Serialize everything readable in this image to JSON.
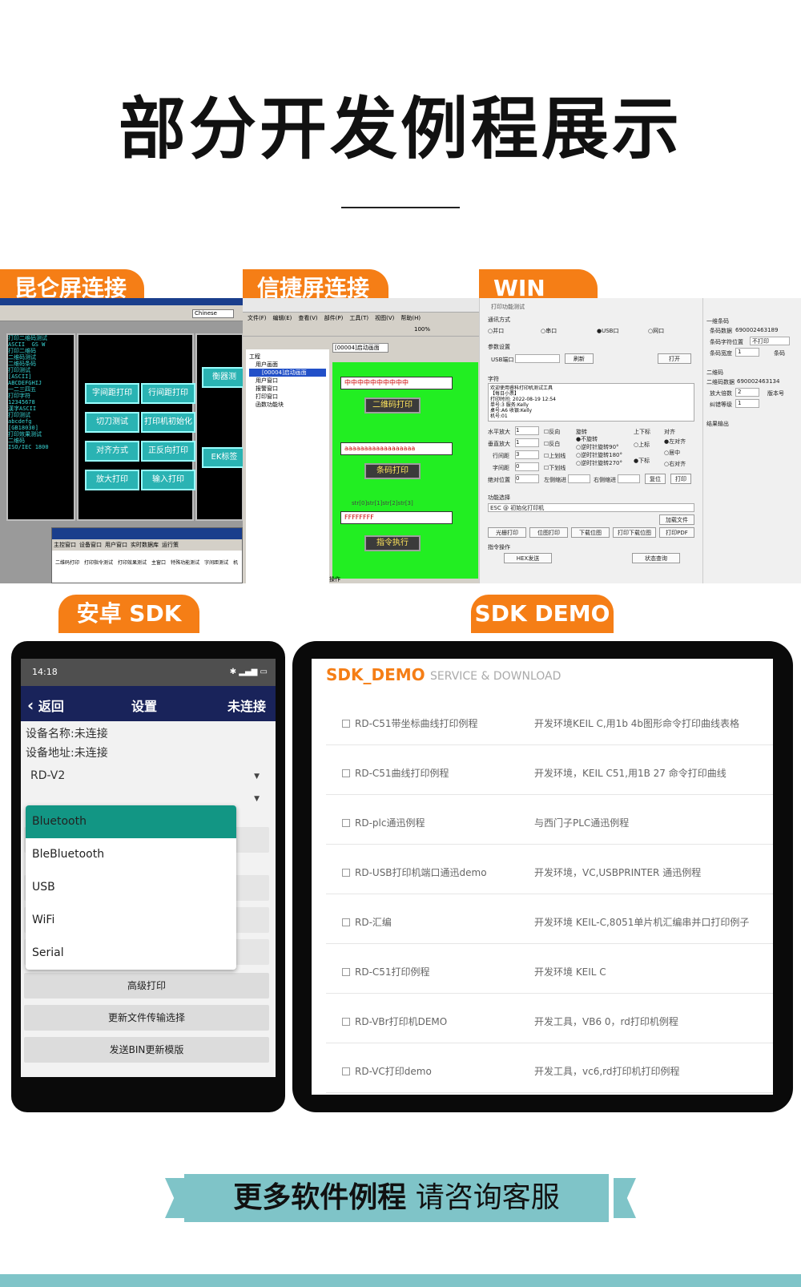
{
  "title": "部分开发例程展示",
  "tabs": {
    "kunlun": "昆仑屏连接",
    "xinjie": "信捷屏连接",
    "winsdk": "WIN SDK",
    "android": "安卓 SDK",
    "demo": "SDK DEMO"
  },
  "kunlun_screen": {
    "buttons": [
      "字间距打印",
      "行间距打印",
      "切刀测试",
      "打印机初始化",
      "对齐方式",
      "正反向打印",
      "放大打印",
      "输入打印"
    ],
    "right_labels": [
      "衡器测",
      "EK标签"
    ],
    "bottom_tabs": [
      "主控窗口",
      "设备窗口",
      "用户窗口",
      "实时数据库",
      "运行策"
    ],
    "bottom_items": [
      "二维码打印",
      "打印指令测试",
      "打印效果测试",
      "主窗口",
      "特殊功能测试",
      "字间距测试",
      "机"
    ],
    "chinese_combo": "Chinese"
  },
  "xinjie_screen": {
    "menu": [
      "文件(F)",
      "编辑(E)",
      "查看(V)",
      "部件(P)",
      "工具(T)",
      "视图(V)",
      "帮助(H)"
    ],
    "tab_title": "[00004]启动画面",
    "tree": [
      "工程",
      "用户画面",
      "[00004]启动画面",
      "用户窗口",
      "报警窗口",
      "打印窗口",
      "函数功能块"
    ],
    "fields": [
      "中中中中中中中中中中",
      "aaaaaaaaaaaaaaaaaa",
      "FFFFFFFF"
    ],
    "buttons": [
      "二维码打印",
      "条码打印",
      "指令执行"
    ],
    "strline": "str[0]str[1]str[2]str[3]",
    "status": "操作",
    "zoom": "100%"
  },
  "winsdk_screen": {
    "window_title": "打印功能测试",
    "comm_label": "通讯方式",
    "comm_options": [
      "并口",
      "串口",
      "USB口",
      "网口"
    ],
    "param_label": "参数设置",
    "usb_port": "USB端口",
    "refresh": "刷新",
    "open": "打开",
    "char_label": "字符",
    "char_text": [
      "欢迎使用睿科打印机测试工具",
      "【每日小票】",
      "打印时间: 2022-08-19 12:54",
      "单号:3         服务:Kelly",
      "桌号:A6       收银:Kelly",
      "机号:01"
    ],
    "params": [
      "水平放大",
      "垂直放大",
      "行间距",
      "字间距",
      "绝对位置"
    ],
    "param_values": [
      "1",
      "1",
      "3",
      "0",
      "0"
    ],
    "checks": [
      "反向",
      "反白",
      "上划线",
      "下划线"
    ],
    "rotate_label": "旋转",
    "rotate": [
      "不旋转",
      "逆时针旋转90°",
      "逆时针旋转180°",
      "逆时针旋转270°"
    ],
    "updown_label": "上下标",
    "updown": [
      "上标",
      "下标"
    ],
    "align_label": "对齐",
    "align": [
      "左对齐",
      "居中",
      "右对齐"
    ],
    "indent_left": "左侧缩进",
    "indent_right": "右侧缩进",
    "reset": "复位",
    "print": "打印",
    "func_label": "功能选择",
    "func_value": "ESC @ 初始化打印机",
    "load_file": "加载文件",
    "func_buttons": [
      "光栅打印",
      "位图打印",
      "下载位图",
      "打印下载位图",
      "打印PDF"
    ],
    "cmd_label": "指令操作",
    "hex_send": "HEX发送",
    "status_query": "状态查询",
    "barcode1_label": "一维条码",
    "barcode1_data_label": "条码数据",
    "barcode1_data": "690002463189",
    "char_pos_label": "条码字符位置",
    "char_pos": "不打印",
    "bar_width_label": "条码宽度",
    "bar_width": "1",
    "bar_height_label": "条码",
    "qr_label": "二维码",
    "qr_data_label": "二维码数据",
    "qr_data": "690002463134",
    "zoom_label": "放大倍数",
    "zoom": "2",
    "version_label": "版本号",
    "ec_label": "纠错等级",
    "ec": "1",
    "result_label": "结果输出"
  },
  "android_screen": {
    "time": "14:18",
    "back": "返回",
    "title": "设置",
    "state": "未连接",
    "device_name": "设备名称:未连接",
    "device_addr": "设备地址:未连接",
    "model": "RD-V2",
    "menu": [
      "Bluetooth",
      "BleBluetooth",
      "USB",
      "WiFi",
      "Serial"
    ],
    "buttons": [
      "高级打印",
      "更新文件传输选择",
      "发送BIN更新模版"
    ]
  },
  "demo_screen": {
    "header": "SDK_DEMO",
    "sub": "SERVICE & DOWNLOAD",
    "rows": [
      {
        "name": "RD-C51带坐标曲线打印例程",
        "desc": "开发环境KEIL C,用1b 4b图形命令打印曲线表格"
      },
      {
        "name": "RD-C51曲线打印例程",
        "desc": "开发环境，KEIL C51,用1B 27 命令打印曲线"
      },
      {
        "name": "RD-plc通迅例程",
        "desc": "与西门子PLC通迅例程"
      },
      {
        "name": "RD-USB打印机端口通迅demo",
        "desc": "开发环境，VC,USBPRINTER 通迅例程"
      },
      {
        "name": "RD-汇编",
        "desc": "开发环境    KEIL-C,8051单片机汇编串并口打印例子"
      },
      {
        "name": "RD-C51打印例程",
        "desc": "开发环境    KEIL C"
      },
      {
        "name": "RD-VBr打印机DEMO",
        "desc": "开发工具，VB6 0，rd打印机例程"
      },
      {
        "name": "RD-VC打印demo",
        "desc": "开发工具，vc6,rd打印机打印例程"
      }
    ]
  },
  "banner": {
    "bold": "更多软件例程",
    "rest": " 请咨询客服"
  },
  "colors": {
    "accent": "#f57e16",
    "teal": "#7fc4c8",
    "android_bar": "#19235a",
    "menu_sel": "#129684"
  }
}
